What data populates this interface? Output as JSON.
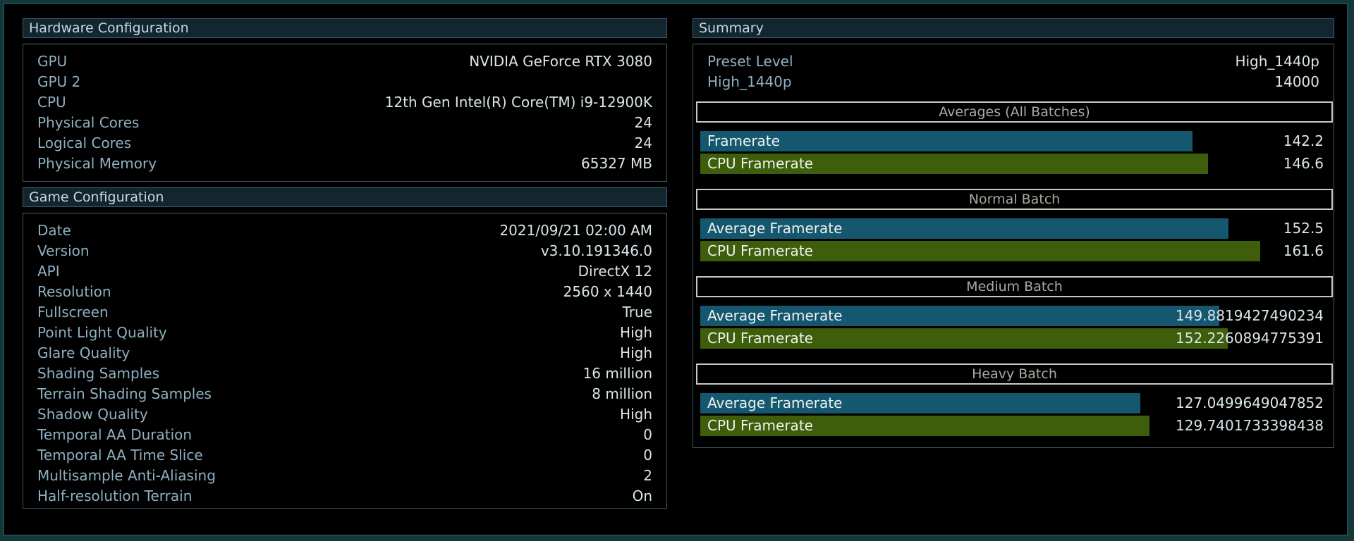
{
  "hardware": {
    "title": "Hardware Configuration",
    "rows": [
      {
        "label": "GPU",
        "value": "NVIDIA GeForce RTX 3080"
      },
      {
        "label": "GPU 2",
        "value": ""
      },
      {
        "label": "CPU",
        "value": "12th Gen Intel(R) Core(TM) i9-12900K"
      },
      {
        "label": "Physical Cores",
        "value": "24"
      },
      {
        "label": "Logical Cores",
        "value": "24"
      },
      {
        "label": "Physical Memory",
        "value": "65327 MB"
      }
    ]
  },
  "game": {
    "title": "Game Configuration",
    "rows": [
      {
        "label": "Date",
        "value": "2021/09/21 02:00 AM"
      },
      {
        "label": "Version",
        "value": "v3.10.191346.0"
      },
      {
        "label": "API",
        "value": "DirectX 12"
      },
      {
        "label": "Resolution",
        "value": "2560 x 1440"
      },
      {
        "label": "Fullscreen",
        "value": "True"
      },
      {
        "label": "Point Light Quality",
        "value": "High"
      },
      {
        "label": "Glare Quality",
        "value": "High"
      },
      {
        "label": "Shading Samples",
        "value": "16 million"
      },
      {
        "label": "Terrain Shading Samples",
        "value": "8 million"
      },
      {
        "label": "Shadow Quality",
        "value": "High"
      },
      {
        "label": "Temporal AA Duration",
        "value": "0"
      },
      {
        "label": "Temporal AA Time Slice",
        "value": "0"
      },
      {
        "label": "Multisample Anti-Aliasing",
        "value": "2"
      },
      {
        "label": "Half-resolution Terrain",
        "value": "On"
      }
    ]
  },
  "summary": {
    "title": "Summary",
    "preset_label": "Preset Level",
    "preset_value": "High_1440p",
    "score_label": "High_1440p",
    "score_value": "14000",
    "bar_max": 180,
    "batches": [
      {
        "title": "Averages (All Batches)",
        "bars": [
          {
            "label": "Framerate",
            "value": "142.2",
            "num": 142.2,
            "color": "#165770"
          },
          {
            "label": "CPU Framerate",
            "value": "146.6",
            "num": 146.6,
            "color": "#3e5e0b"
          }
        ]
      },
      {
        "title": "Normal Batch",
        "bars": [
          {
            "label": "Average Framerate",
            "value": "152.5",
            "num": 152.5,
            "color": "#165770"
          },
          {
            "label": "CPU Framerate",
            "value": "161.6",
            "num": 161.6,
            "color": "#3e5e0b"
          }
        ]
      },
      {
        "title": "Medium Batch",
        "bars": [
          {
            "label": "Average Framerate",
            "value": "149.8819427490234",
            "num": 149.8819427490234,
            "color": "#165770"
          },
          {
            "label": "CPU Framerate",
            "value": "152.2260894775391",
            "num": 152.2260894775391,
            "color": "#3e5e0b"
          }
        ]
      },
      {
        "title": "Heavy Batch",
        "bars": [
          {
            "label": "Average Framerate",
            "value": "127.0499649047852",
            "num": 127.0499649047852,
            "color": "#165770"
          },
          {
            "label": "CPU Framerate",
            "value": "129.7401733398438",
            "num": 129.7401733398438,
            "color": "#3e5e0b"
          }
        ]
      }
    ]
  }
}
